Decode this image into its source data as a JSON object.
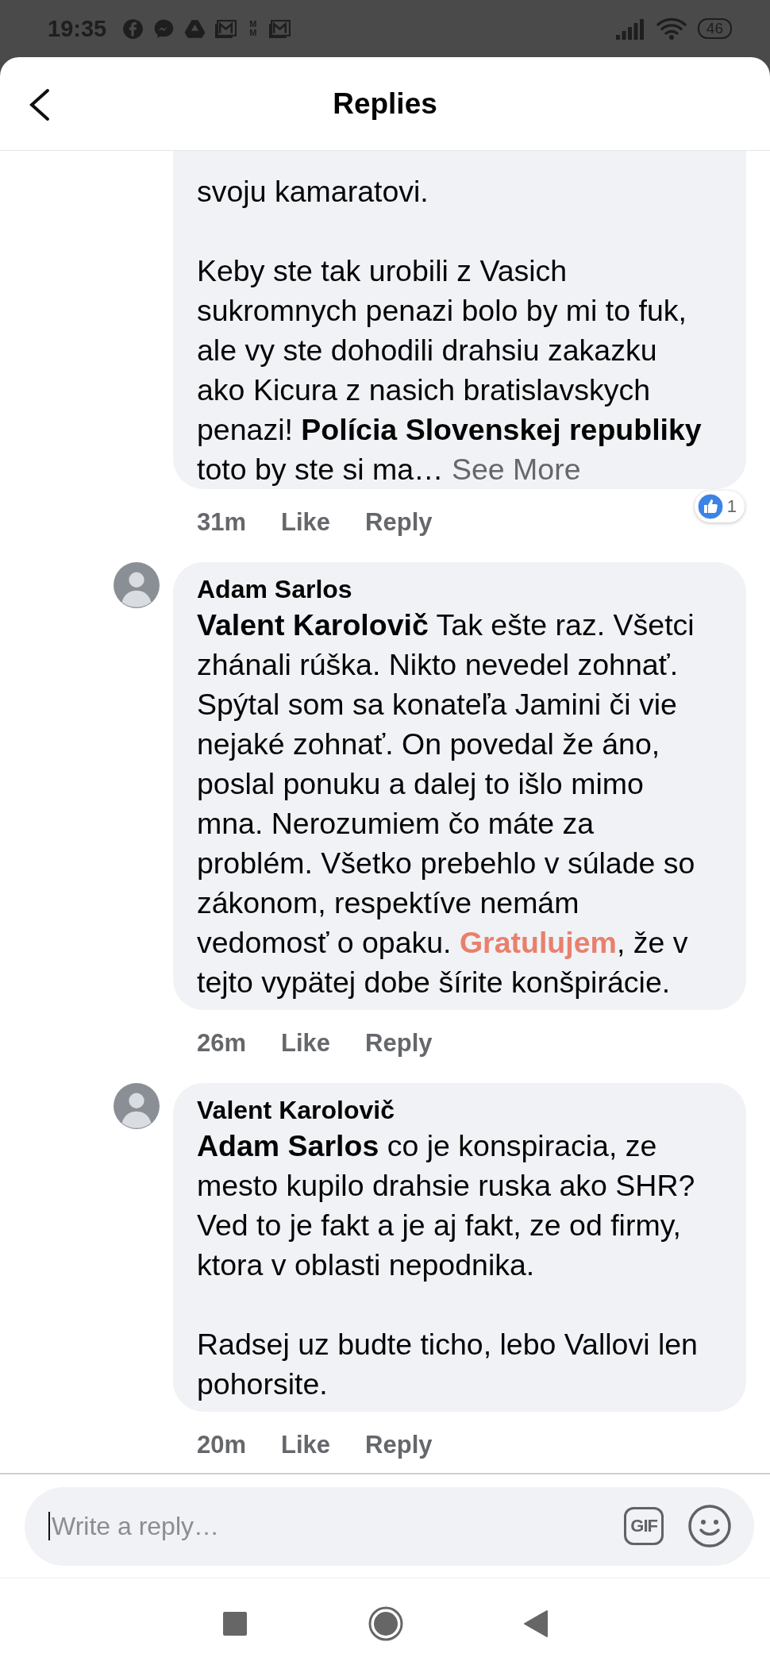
{
  "status_bar": {
    "time": "19:35",
    "notifications": [
      {
        "kind": "facebook"
      },
      {
        "kind": "messenger"
      },
      {
        "kind": "drive"
      },
      {
        "kind": "mail"
      },
      {
        "kind": "letters",
        "lines": [
          "M",
          "M"
        ]
      },
      {
        "kind": "mail"
      }
    ],
    "battery": "46"
  },
  "header": {
    "title": "Replies"
  },
  "comments": [
    {
      "body": [
        {
          "kind": "plain",
          "text": "svoju kamaratovi.\n\nKeby ste tak urobili z Vasich\nsukromnych penazi bolo by mi to fuk,\nale vy ste dohodili drahsiu zakazku\nako Kicura z nasich bratislavskych\npenazi! "
        },
        {
          "kind": "bold",
          "text": "Polícia Slovenskej republiky"
        },
        {
          "kind": "plain",
          "text": "\ntoto by ste si ma… "
        },
        {
          "kind": "link",
          "text": "See More"
        }
      ],
      "time": "31m",
      "actions": [
        "Like",
        "Reply"
      ],
      "reactions": "1"
    },
    {
      "author": "Adam Sarlos",
      "has_avatar": true,
      "body": [
        {
          "kind": "mention",
          "text": "Valent Karolovič"
        },
        {
          "kind": "plain",
          "text": " Tak ešte raz. Všetci\nzhánali rúška. Nikto nevedel zohnať.\nSpýtal som sa konateľa Jamini či vie\nnejaké zohnať. On povedal že áno,\nposlal ponuku a dalej to išlo mimo\nmna. Nerozumiem čo máte za\nproblém. Všetko prebehlo v súlade so\nzákonom, respektíve nemám\nvedomosť o opaku. "
        },
        {
          "kind": "highlight",
          "text": "Gratulujem"
        },
        {
          "kind": "plain",
          "text": ", že v\ntejto vypätej dobe šírite konšpirácie."
        }
      ],
      "time": "26m",
      "actions": [
        "Like",
        "Reply"
      ]
    },
    {
      "author": "Valent Karolovič",
      "has_avatar": true,
      "body": [
        {
          "kind": "mention",
          "text": "Adam Sarlos"
        },
        {
          "kind": "plain",
          "text": " co je konspiracia, ze\nmesto kupilo drahsie ruska ako SHR?\nVed to je fakt a je aj fakt, ze od firmy,\nktora v oblasti nepodnika.\n\nRadsej uz budte ticho, lebo Vallovi len\npohorsite."
        }
      ],
      "time": "20m",
      "actions": [
        "Like",
        "Reply"
      ]
    }
  ],
  "composer": {
    "placeholder": "Write a reply…",
    "gif": "GIF"
  }
}
